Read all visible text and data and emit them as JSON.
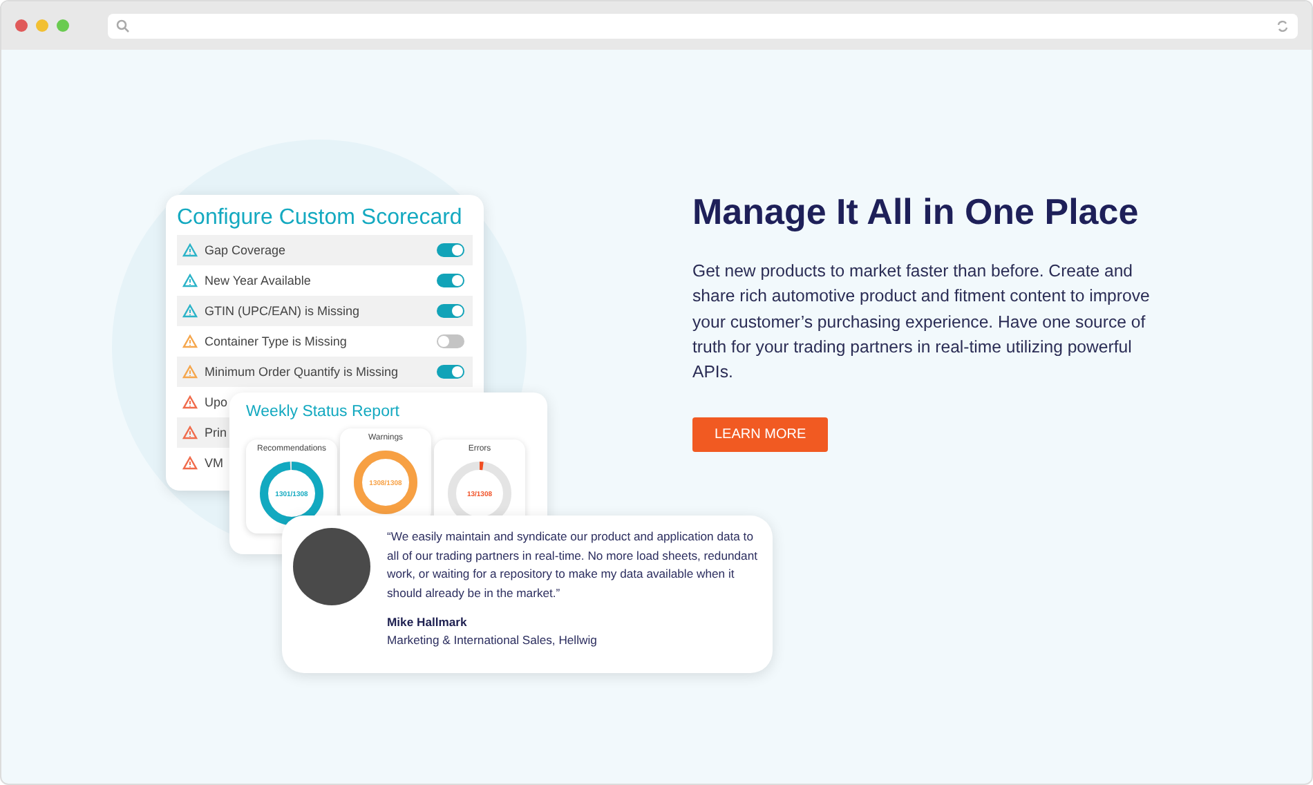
{
  "scorecard": {
    "title": "Configure Custom Scorecard",
    "rows": [
      {
        "label": "Gap Coverage",
        "color": "#2bb3c8",
        "on": true
      },
      {
        "label": "New Year Available",
        "color": "#2bb3c8",
        "on": true
      },
      {
        "label": "GTIN (UPC/EAN) is Missing",
        "color": "#2bb3c8",
        "on": true
      },
      {
        "label": "Container Type is Missing",
        "color": "#f5a64c",
        "on": false
      },
      {
        "label": "Minimum Order Quantify is Missing",
        "color": "#f5a64c",
        "on": true
      },
      {
        "label": "Upo",
        "color": "#f06b4b"
      },
      {
        "label": "Prin",
        "color": "#f06b4b"
      },
      {
        "label": "VM",
        "color": "#f06b4b"
      }
    ]
  },
  "report": {
    "title": "Weekly Status Report",
    "gauges": [
      {
        "label": "Recommendations",
        "reading": "1301/1308",
        "level": 0.99,
        "color": "#12a9c0",
        "raised": false
      },
      {
        "label": "Warnings",
        "reading": "1308/1308",
        "level": 1,
        "color": "#f7a043",
        "raised": true
      },
      {
        "label": "Errors",
        "reading": "13/1308",
        "level": 0.02,
        "color": "#f04e23",
        "raised": false
      }
    ]
  },
  "testimonial": {
    "quote": "“We easily maintain and syndicate our product and application data to all of our trading partners in real-time. No more load sheets, redundant work, or waiting for a repository to make my data available when it should already be in the market.”",
    "name": "Mike Hallmark",
    "role": "Marketing & International Sales, Hellwig"
  },
  "hero": {
    "heading": "Manage It All in One Place",
    "body": "Get new products to market faster than before. Create and share rich automotive product and fitment content to improve your customer’s purchasing experience. Have one source of truth for your trading partners in real-time utilizing powerful APIs.",
    "button": "LEARN MORE"
  }
}
